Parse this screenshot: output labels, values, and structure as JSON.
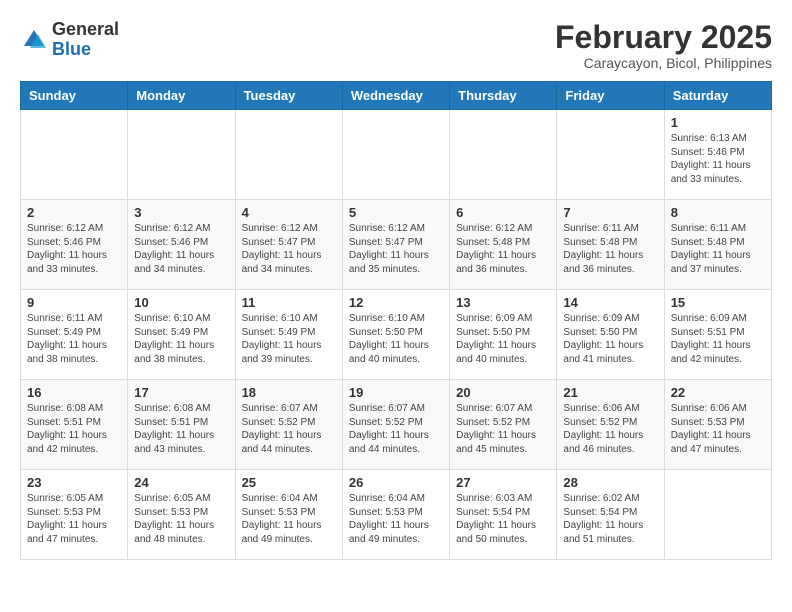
{
  "header": {
    "logo_general": "General",
    "logo_blue": "Blue",
    "month_year": "February 2025",
    "location": "Caraycayon, Bicol, Philippines"
  },
  "weekdays": [
    "Sunday",
    "Monday",
    "Tuesday",
    "Wednesday",
    "Thursday",
    "Friday",
    "Saturday"
  ],
  "weeks": [
    [
      {
        "day": "",
        "info": ""
      },
      {
        "day": "",
        "info": ""
      },
      {
        "day": "",
        "info": ""
      },
      {
        "day": "",
        "info": ""
      },
      {
        "day": "",
        "info": ""
      },
      {
        "day": "",
        "info": ""
      },
      {
        "day": "1",
        "info": "Sunrise: 6:13 AM\nSunset: 5:46 PM\nDaylight: 11 hours\nand 33 minutes."
      }
    ],
    [
      {
        "day": "2",
        "info": "Sunrise: 6:12 AM\nSunset: 5:46 PM\nDaylight: 11 hours\nand 33 minutes."
      },
      {
        "day": "3",
        "info": "Sunrise: 6:12 AM\nSunset: 5:46 PM\nDaylight: 11 hours\nand 34 minutes."
      },
      {
        "day": "4",
        "info": "Sunrise: 6:12 AM\nSunset: 5:47 PM\nDaylight: 11 hours\nand 34 minutes."
      },
      {
        "day": "5",
        "info": "Sunrise: 6:12 AM\nSunset: 5:47 PM\nDaylight: 11 hours\nand 35 minutes."
      },
      {
        "day": "6",
        "info": "Sunrise: 6:12 AM\nSunset: 5:48 PM\nDaylight: 11 hours\nand 36 minutes."
      },
      {
        "day": "7",
        "info": "Sunrise: 6:11 AM\nSunset: 5:48 PM\nDaylight: 11 hours\nand 36 minutes."
      },
      {
        "day": "8",
        "info": "Sunrise: 6:11 AM\nSunset: 5:48 PM\nDaylight: 11 hours\nand 37 minutes."
      }
    ],
    [
      {
        "day": "9",
        "info": "Sunrise: 6:11 AM\nSunset: 5:49 PM\nDaylight: 11 hours\nand 38 minutes."
      },
      {
        "day": "10",
        "info": "Sunrise: 6:10 AM\nSunset: 5:49 PM\nDaylight: 11 hours\nand 38 minutes."
      },
      {
        "day": "11",
        "info": "Sunrise: 6:10 AM\nSunset: 5:49 PM\nDaylight: 11 hours\nand 39 minutes."
      },
      {
        "day": "12",
        "info": "Sunrise: 6:10 AM\nSunset: 5:50 PM\nDaylight: 11 hours\nand 40 minutes."
      },
      {
        "day": "13",
        "info": "Sunrise: 6:09 AM\nSunset: 5:50 PM\nDaylight: 11 hours\nand 40 minutes."
      },
      {
        "day": "14",
        "info": "Sunrise: 6:09 AM\nSunset: 5:50 PM\nDaylight: 11 hours\nand 41 minutes."
      },
      {
        "day": "15",
        "info": "Sunrise: 6:09 AM\nSunset: 5:51 PM\nDaylight: 11 hours\nand 42 minutes."
      }
    ],
    [
      {
        "day": "16",
        "info": "Sunrise: 6:08 AM\nSunset: 5:51 PM\nDaylight: 11 hours\nand 42 minutes."
      },
      {
        "day": "17",
        "info": "Sunrise: 6:08 AM\nSunset: 5:51 PM\nDaylight: 11 hours\nand 43 minutes."
      },
      {
        "day": "18",
        "info": "Sunrise: 6:07 AM\nSunset: 5:52 PM\nDaylight: 11 hours\nand 44 minutes."
      },
      {
        "day": "19",
        "info": "Sunrise: 6:07 AM\nSunset: 5:52 PM\nDaylight: 11 hours\nand 44 minutes."
      },
      {
        "day": "20",
        "info": "Sunrise: 6:07 AM\nSunset: 5:52 PM\nDaylight: 11 hours\nand 45 minutes."
      },
      {
        "day": "21",
        "info": "Sunrise: 6:06 AM\nSunset: 5:52 PM\nDaylight: 11 hours\nand 46 minutes."
      },
      {
        "day": "22",
        "info": "Sunrise: 6:06 AM\nSunset: 5:53 PM\nDaylight: 11 hours\nand 47 minutes."
      }
    ],
    [
      {
        "day": "23",
        "info": "Sunrise: 6:05 AM\nSunset: 5:53 PM\nDaylight: 11 hours\nand 47 minutes."
      },
      {
        "day": "24",
        "info": "Sunrise: 6:05 AM\nSunset: 5:53 PM\nDaylight: 11 hours\nand 48 minutes."
      },
      {
        "day": "25",
        "info": "Sunrise: 6:04 AM\nSunset: 5:53 PM\nDaylight: 11 hours\nand 49 minutes."
      },
      {
        "day": "26",
        "info": "Sunrise: 6:04 AM\nSunset: 5:53 PM\nDaylight: 11 hours\nand 49 minutes."
      },
      {
        "day": "27",
        "info": "Sunrise: 6:03 AM\nSunset: 5:54 PM\nDaylight: 11 hours\nand 50 minutes."
      },
      {
        "day": "28",
        "info": "Sunrise: 6:02 AM\nSunset: 5:54 PM\nDaylight: 11 hours\nand 51 minutes."
      },
      {
        "day": "",
        "info": ""
      }
    ]
  ]
}
